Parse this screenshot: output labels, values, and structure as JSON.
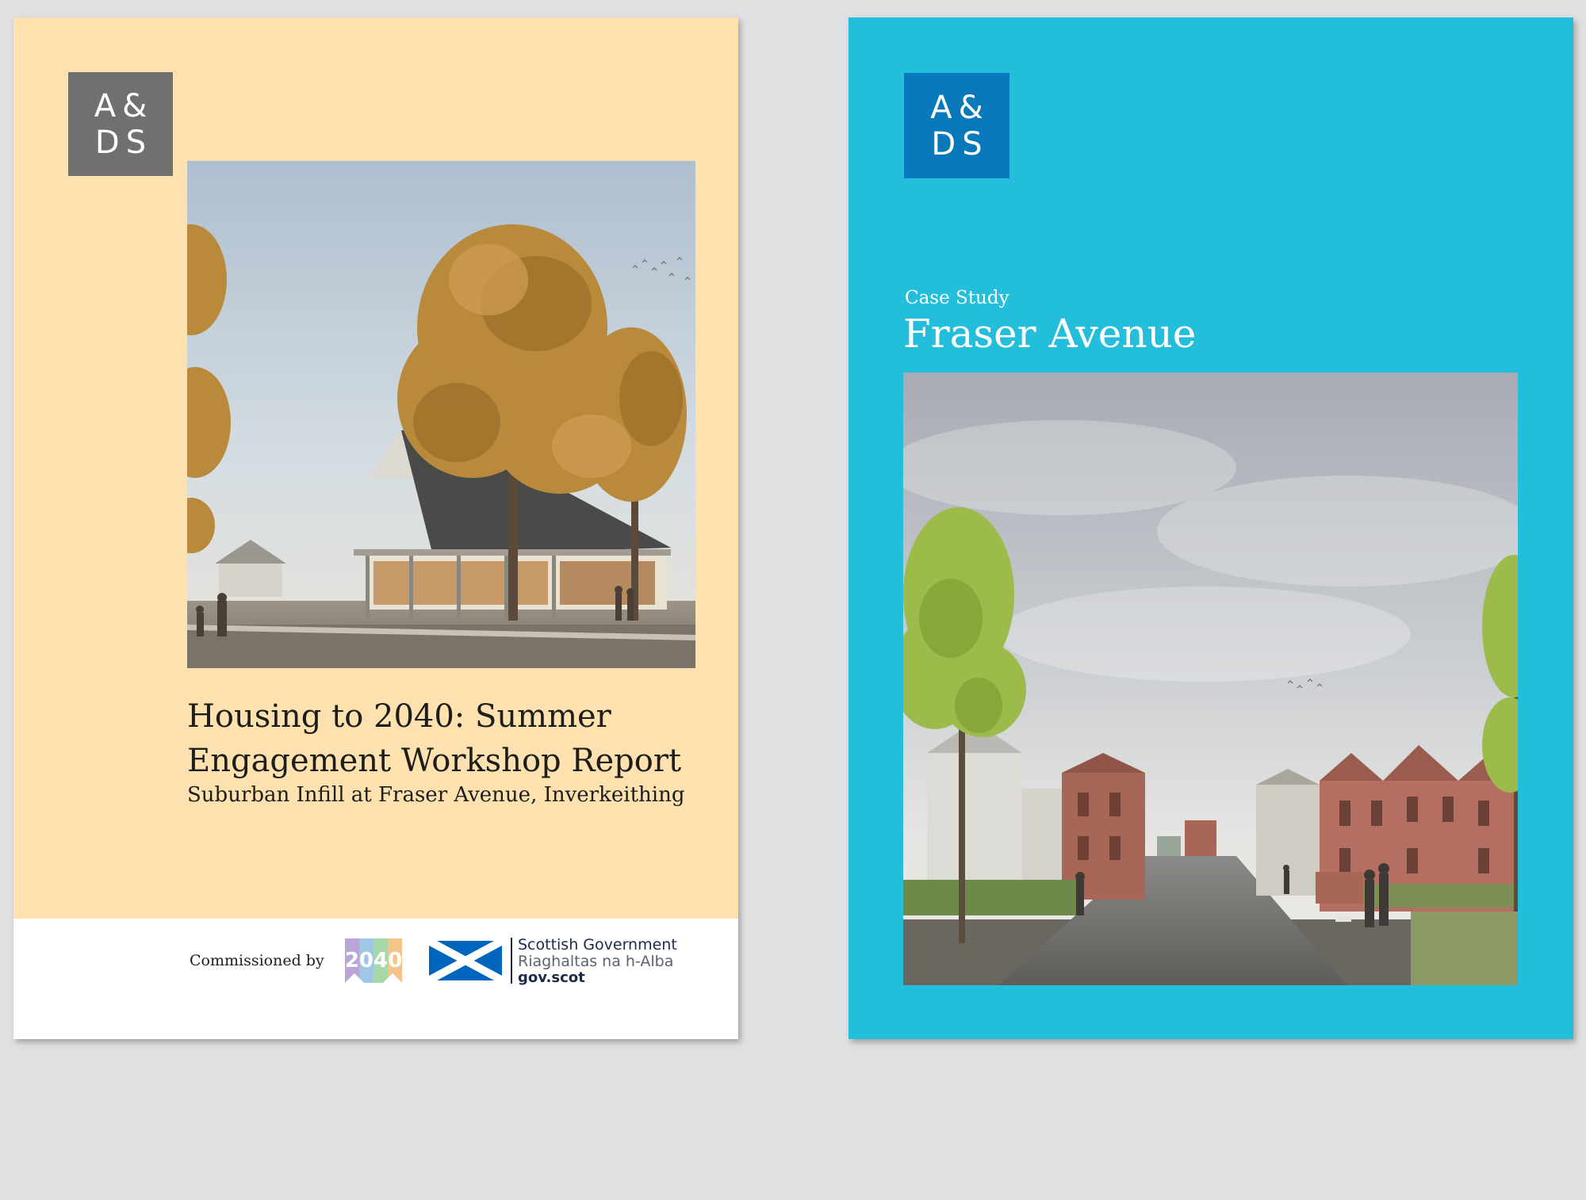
{
  "colors": {
    "page_background": "#dfe0e2",
    "left_cover_background": "#fde1ae",
    "right_cover_background": "#22bedb",
    "left_logo_background": "#707070",
    "right_logo_background": "#0a79bb",
    "text_dark": "#1d1d1b",
    "saltire_blue": "#0065bd"
  },
  "left_cover": {
    "logo": {
      "line1": "A&",
      "line2": "DS"
    },
    "hero_image": "rendering of a pitched-roof community building among autumn trees",
    "title": "Housing to 2040: Summer Engagement Workshop Report",
    "subtitle": "Suburban Infill at Fraser Avenue, Inverkeithing",
    "footer": {
      "commissioned_label": "Commissioned by",
      "logo_2040_text": "2040",
      "government": {
        "line1": "Scottish Government",
        "line2": "Riaghaltas na h-Alba",
        "line3": "gov.scot"
      }
    }
  },
  "right_cover": {
    "logo": {
      "line1": "A&",
      "line2": "DS"
    },
    "label": "Case Study",
    "title": "Fraser Avenue",
    "hero_image": "rendering of a residential street with brick terraced houses"
  }
}
